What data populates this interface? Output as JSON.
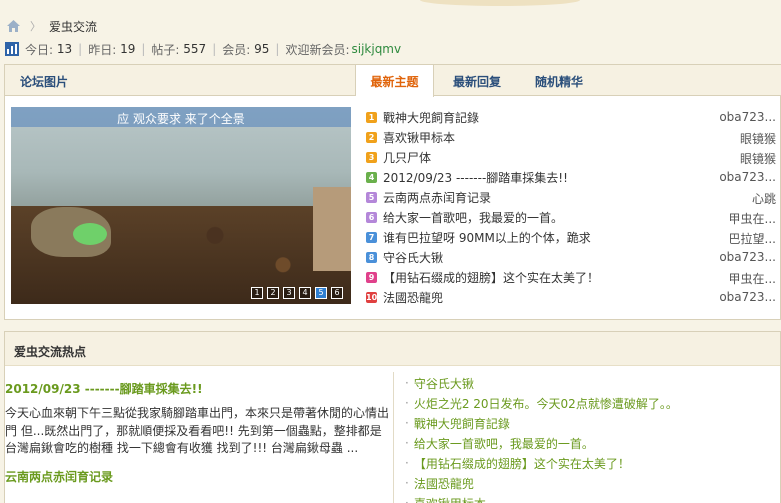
{
  "breadcrumb": {
    "forum_name": "爱虫交流"
  },
  "stats": {
    "today_label": "今日:",
    "today": "13",
    "yesterday_label": "昨日:",
    "yesterday": "19",
    "posts_label": "帖子:",
    "posts": "557",
    "members_label": "会员:",
    "members": "95",
    "welcome_label": "欢迎新会员:",
    "new_member": "sijkjqmv"
  },
  "gallery": {
    "header": "论坛图片",
    "caption": "应 观众要求 来了个全景",
    "pager": [
      "1",
      "2",
      "3",
      "4",
      "5",
      "6"
    ],
    "active_page": 5
  },
  "tabs": [
    {
      "label": "最新主题",
      "active": true
    },
    {
      "label": "最新回复",
      "active": false
    },
    {
      "label": "随机精华",
      "active": false
    }
  ],
  "topics": [
    {
      "num": "1",
      "color": "#f0a11b",
      "title": "戰神大兜飼育記錄",
      "author": "oba723..."
    },
    {
      "num": "2",
      "color": "#f0a11b",
      "title": "喜欢锹甲标本",
      "author": "眼镜猴"
    },
    {
      "num": "3",
      "color": "#f0a11b",
      "title": "几只尸体",
      "author": "眼镜猴"
    },
    {
      "num": "4",
      "color": "#6ab04c",
      "title": "2012/09/23 -------腳踏車採集去!!",
      "author": "oba723..."
    },
    {
      "num": "5",
      "color": "#b487d9",
      "title": "云南两点赤闰育记录",
      "author": "心跳"
    },
    {
      "num": "6",
      "color": "#b487d9",
      "title": "给大家一首歌吧，我最爱的一首。",
      "author": "甲虫在..."
    },
    {
      "num": "7",
      "color": "#4a90d9",
      "title": "谁有巴拉望呀 90MM以上的个体，跪求",
      "author": "巴拉望..."
    },
    {
      "num": "8",
      "color": "#4a90d9",
      "title": "守谷氏大锹",
      "author": "oba723..."
    },
    {
      "num": "9",
      "color": "#e0418b",
      "title": "【用钻石缀成的翅膀】这个实在太美了！",
      "author": "甲虫在..."
    },
    {
      "num": "10",
      "color": "#e04040",
      "title": "法國恐龍兜",
      "author": "oba723..."
    }
  ],
  "hot": {
    "header": "爱虫交流热点",
    "featured_title": "2012/09/23 -------腳踏車採集去!!",
    "featured_body": "今天心血來朝下午三點從我家騎腳踏車出門，本來只是帶著休閒的心情出門 但...既然出門了，那就順便採及看看吧!! 先到第一個蟲點，整排都是台灣扁鍬會吃的樹種 找一下總會有收獲 找到了!!! 台灣扁鍬母蟲 ...",
    "second_title": "云南两点赤闰育记录",
    "list": [
      "守谷氏大锹",
      "火炬之光2 20日发布。今天02点就惨遭破解了。。",
      "戰神大兜飼育記錄",
      "给大家一首歌吧，我最爱的一首。",
      "【用钻石缀成的翅膀】这个实在太美了！",
      "法國恐龍兜",
      "喜欢锹甲标本"
    ],
    "bullet": "·"
  }
}
